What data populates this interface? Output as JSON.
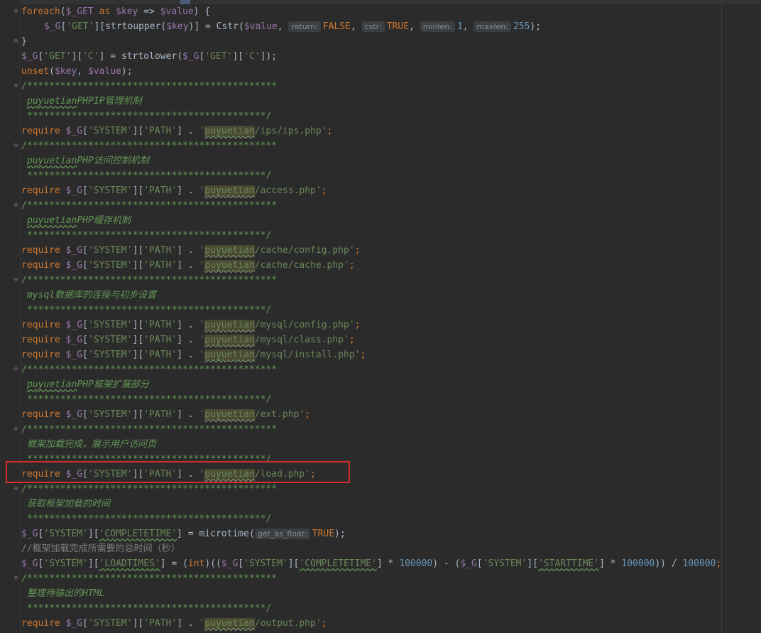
{
  "editor": {
    "accent_highlight": "#d32c2c",
    "lines": [
      {
        "fold": true,
        "segments": [
          [
            "kw",
            "foreach"
          ],
          [
            "",
            "("
          ],
          [
            "var",
            "$_GET"
          ],
          [
            "kw",
            " as "
          ],
          [
            "var",
            "$key"
          ],
          [
            "",
            " => "
          ],
          [
            "var",
            "$value"
          ],
          [
            "",
            ") {"
          ]
        ]
      },
      {
        "indent": true,
        "segments": [
          [
            "var",
            "$_G"
          ],
          [
            "",
            "["
          ],
          [
            "str",
            "'GET'"
          ],
          [
            "",
            "]["
          ],
          [
            "fn",
            "strtoupper"
          ],
          [
            "",
            "("
          ],
          [
            "var",
            "$key"
          ],
          [
            "",
            ")] = "
          ],
          [
            "fn",
            "Cstr"
          ],
          [
            "",
            "("
          ],
          [
            "var",
            "$value"
          ],
          [
            "",
            ", "
          ],
          [
            "hint",
            "return:"
          ],
          [
            "kw",
            "FALSE"
          ],
          [
            "",
            ", "
          ],
          [
            "hint",
            "cstr:"
          ],
          [
            "kw",
            "TRUE"
          ],
          [
            "",
            ", "
          ],
          [
            "hint",
            "minlen:"
          ],
          [
            "num",
            "1"
          ],
          [
            "",
            ", "
          ],
          [
            "hint",
            "maxlen:"
          ],
          [
            "num",
            "255"
          ],
          [
            "",
            ");"
          ]
        ]
      },
      {
        "fold": true,
        "segments": [
          [
            "",
            "}"
          ]
        ]
      },
      {
        "segments": [
          [
            "var",
            "$_G"
          ],
          [
            "",
            "["
          ],
          [
            "str",
            "'GET'"
          ],
          [
            "",
            "]["
          ],
          [
            "str",
            "'C'"
          ],
          [
            "",
            "] = "
          ],
          [
            "fn",
            "strtolower"
          ],
          [
            "",
            "("
          ],
          [
            "var",
            "$_G"
          ],
          [
            "",
            "["
          ],
          [
            "str",
            "'GET'"
          ],
          [
            "",
            "]["
          ],
          [
            "str",
            "'C'"
          ],
          [
            "",
            "]);"
          ]
        ]
      },
      {
        "segments": [
          [
            "kw",
            "unset"
          ],
          [
            "",
            "("
          ],
          [
            "var",
            "$key"
          ],
          [
            "",
            ", "
          ],
          [
            "var",
            "$value"
          ],
          [
            "",
            ");"
          ]
        ]
      },
      {
        "fold": true,
        "segments": [
          [
            "cmt",
            "/*********************************************"
          ]
        ]
      },
      {
        "comment": true,
        "segments": [
          [
            "cmti typo",
            "puyuetian"
          ],
          [
            "cmti",
            "PHPIP管理机制"
          ]
        ]
      },
      {
        "comment": true,
        "segments": [
          [
            "cmt",
            "*******************************************/"
          ]
        ]
      },
      {
        "segments": [
          [
            "kw",
            "require "
          ],
          [
            "var",
            "$_G"
          ],
          [
            "",
            "["
          ],
          [
            "str",
            "'SYSTEM'"
          ],
          [
            "",
            "]["
          ],
          [
            "str",
            "'PATH'"
          ],
          [
            "",
            "] . "
          ],
          [
            "str",
            "'"
          ],
          [
            "str hl",
            "puyuetian"
          ],
          [
            "str",
            "/ips/ips.php'"
          ],
          [
            "kw",
            ";"
          ]
        ]
      },
      {
        "fold": true,
        "segments": [
          [
            "cmt",
            "/*********************************************"
          ]
        ]
      },
      {
        "comment": true,
        "segments": [
          [
            "cmti typo",
            "puyuetian"
          ],
          [
            "cmti",
            "PHP访问控制机制"
          ]
        ]
      },
      {
        "comment": true,
        "segments": [
          [
            "cmt",
            "*******************************************/"
          ]
        ]
      },
      {
        "segments": [
          [
            "kw",
            "require "
          ],
          [
            "var",
            "$_G"
          ],
          [
            "",
            "["
          ],
          [
            "str",
            "'SYSTEM'"
          ],
          [
            "",
            "]["
          ],
          [
            "str",
            "'PATH'"
          ],
          [
            "",
            "] . "
          ],
          [
            "str",
            "'"
          ],
          [
            "str hl",
            "puyuetian"
          ],
          [
            "str",
            "/access.php'"
          ],
          [
            "kw",
            ";"
          ]
        ]
      },
      {
        "fold": true,
        "segments": [
          [
            "cmt",
            "/*********************************************"
          ]
        ]
      },
      {
        "comment": true,
        "segments": [
          [
            "cmti typo",
            "puyuetian"
          ],
          [
            "cmti",
            "PHP缓存机制"
          ]
        ]
      },
      {
        "comment": true,
        "segments": [
          [
            "cmt",
            "*******************************************/"
          ]
        ]
      },
      {
        "segments": [
          [
            "kw",
            "require "
          ],
          [
            "var",
            "$_G"
          ],
          [
            "",
            "["
          ],
          [
            "str",
            "'SYSTEM'"
          ],
          [
            "",
            "]["
          ],
          [
            "str",
            "'PATH'"
          ],
          [
            "",
            "] . "
          ],
          [
            "str",
            "'"
          ],
          [
            "str hl",
            "puyuetian"
          ],
          [
            "str",
            "/cache/config.php'"
          ],
          [
            "kw",
            ";"
          ]
        ]
      },
      {
        "segments": [
          [
            "kw",
            "require "
          ],
          [
            "var",
            "$_G"
          ],
          [
            "",
            "["
          ],
          [
            "str",
            "'SYSTEM'"
          ],
          [
            "",
            "]["
          ],
          [
            "str",
            "'PATH'"
          ],
          [
            "",
            "] . "
          ],
          [
            "str",
            "'"
          ],
          [
            "str hl",
            "puyuetian"
          ],
          [
            "str",
            "/cache/cache.php'"
          ],
          [
            "kw",
            ";"
          ]
        ]
      },
      {
        "fold": true,
        "segments": [
          [
            "cmt",
            "/*********************************************"
          ]
        ]
      },
      {
        "comment": true,
        "segments": [
          [
            "cmti",
            "mysql数据库的连接与初步设置"
          ]
        ]
      },
      {
        "comment": true,
        "segments": [
          [
            "cmt",
            "*******************************************/"
          ]
        ]
      },
      {
        "segments": [
          [
            "kw",
            "require "
          ],
          [
            "var",
            "$_G"
          ],
          [
            "",
            "["
          ],
          [
            "str",
            "'SYSTEM'"
          ],
          [
            "",
            "]["
          ],
          [
            "str",
            "'PATH'"
          ],
          [
            "",
            "] . "
          ],
          [
            "str",
            "'"
          ],
          [
            "str hl",
            "puyuetian"
          ],
          [
            "str",
            "/mysql/config.php'"
          ],
          [
            "kw",
            ";"
          ]
        ]
      },
      {
        "segments": [
          [
            "kw",
            "require "
          ],
          [
            "var",
            "$_G"
          ],
          [
            "",
            "["
          ],
          [
            "str",
            "'SYSTEM'"
          ],
          [
            "",
            "]["
          ],
          [
            "str",
            "'PATH'"
          ],
          [
            "",
            "] . "
          ],
          [
            "str",
            "'"
          ],
          [
            "str hl",
            "puyuetian"
          ],
          [
            "str",
            "/mysql/class.php'"
          ],
          [
            "kw",
            ";"
          ]
        ]
      },
      {
        "segments": [
          [
            "kw",
            "require "
          ],
          [
            "var",
            "$_G"
          ],
          [
            "",
            "["
          ],
          [
            "str",
            "'SYSTEM'"
          ],
          [
            "",
            "]["
          ],
          [
            "str",
            "'PATH'"
          ],
          [
            "",
            "] . "
          ],
          [
            "str",
            "'"
          ],
          [
            "str hl",
            "puyuetian"
          ],
          [
            "str",
            "/mysql/install.php'"
          ],
          [
            "kw",
            ";"
          ]
        ]
      },
      {
        "fold": true,
        "segments": [
          [
            "cmt",
            "/*********************************************"
          ]
        ]
      },
      {
        "comment": true,
        "segments": [
          [
            "cmti typo",
            "puyuetian"
          ],
          [
            "cmti",
            "PHP框架扩展部分"
          ]
        ]
      },
      {
        "comment": true,
        "segments": [
          [
            "cmt",
            "*******************************************/"
          ]
        ]
      },
      {
        "segments": [
          [
            "kw",
            "require "
          ],
          [
            "var",
            "$_G"
          ],
          [
            "",
            "["
          ],
          [
            "str",
            "'SYSTEM'"
          ],
          [
            "",
            "]["
          ],
          [
            "str",
            "'PATH'"
          ],
          [
            "",
            "] . "
          ],
          [
            "str",
            "'"
          ],
          [
            "str hl",
            "puyuetian"
          ],
          [
            "str",
            "/ext.php'"
          ],
          [
            "kw",
            ";"
          ]
        ]
      },
      {
        "fold": true,
        "segments": [
          [
            "cmt",
            "/*********************************************"
          ]
        ]
      },
      {
        "comment": true,
        "segments": [
          [
            "cmti",
            "框架加载完成，展示用户访问页"
          ]
        ]
      },
      {
        "comment": true,
        "segments": [
          [
            "cmt",
            "*******************************************/"
          ]
        ]
      },
      {
        "boxed": true,
        "segments": [
          [
            "kw",
            "require "
          ],
          [
            "var",
            "$_G"
          ],
          [
            "",
            "["
          ],
          [
            "str",
            "'SYSTEM'"
          ],
          [
            "",
            "]["
          ],
          [
            "str",
            "'PATH'"
          ],
          [
            "",
            "] . "
          ],
          [
            "str",
            "'"
          ],
          [
            "str hl",
            "puyuetian"
          ],
          [
            "str",
            "/load.php'"
          ],
          [
            "kw",
            ";"
          ]
        ]
      },
      {
        "fold": true,
        "segments": [
          [
            "cmt",
            "/*********************************************"
          ]
        ]
      },
      {
        "comment": true,
        "segments": [
          [
            "cmti",
            "获取框架加载的时间"
          ]
        ]
      },
      {
        "comment": true,
        "segments": [
          [
            "cmt",
            "*******************************************/"
          ]
        ]
      },
      {
        "segments": [
          [
            "var",
            "$_G"
          ],
          [
            "",
            "["
          ],
          [
            "str",
            "'SYSTEM'"
          ],
          [
            "",
            "]["
          ],
          [
            "str typo",
            "'COMPLETETIME'"
          ],
          [
            "",
            "] = "
          ],
          [
            "fn",
            "microtime"
          ],
          [
            "",
            "("
          ],
          [
            "hint",
            "get_as_float:"
          ],
          [
            "kw",
            "TRUE"
          ],
          [
            "",
            ");"
          ]
        ]
      },
      {
        "segments": [
          [
            "cmtg",
            "//框架加载完成所需要的总时间（秒）"
          ]
        ]
      },
      {
        "segments": [
          [
            "var",
            "$_G"
          ],
          [
            "",
            "["
          ],
          [
            "str",
            "'SYSTEM'"
          ],
          [
            "",
            "]["
          ],
          [
            "str typo",
            "'LOADTIMES'"
          ],
          [
            "",
            "] = ("
          ],
          [
            "kw",
            "int"
          ],
          [
            "",
            ")(("
          ],
          [
            "var",
            "$_G"
          ],
          [
            "",
            "["
          ],
          [
            "str",
            "'SYSTEM'"
          ],
          [
            "",
            "]["
          ],
          [
            "str typo",
            "'COMPLETETIME'"
          ],
          [
            "",
            "] * "
          ],
          [
            "num",
            "100000"
          ],
          [
            "",
            ") - ("
          ],
          [
            "var",
            "$_G"
          ],
          [
            "",
            "["
          ],
          [
            "str",
            "'SYSTEM'"
          ],
          [
            "",
            "]["
          ],
          [
            "str typo",
            "'STARTTIME'"
          ],
          [
            "",
            "] * "
          ],
          [
            "num",
            "100000"
          ],
          [
            "",
            ")) / "
          ],
          [
            "num",
            "100000"
          ],
          [
            "kw",
            ";"
          ]
        ]
      },
      {
        "fold": true,
        "segments": [
          [
            "cmt",
            "/*********************************************"
          ]
        ]
      },
      {
        "comment": true,
        "segments": [
          [
            "cmti",
            "整理待输出的HTML"
          ]
        ]
      },
      {
        "comment": true,
        "segments": [
          [
            "cmt",
            "*******************************************/"
          ]
        ]
      },
      {
        "segments": [
          [
            "kw",
            "require "
          ],
          [
            "var",
            "$_G"
          ],
          [
            "",
            "["
          ],
          [
            "str",
            "'SYSTEM'"
          ],
          [
            "",
            "]["
          ],
          [
            "str",
            "'PATH'"
          ],
          [
            "",
            "] . "
          ],
          [
            "str",
            "'"
          ],
          [
            "str hl",
            "puyuetian"
          ],
          [
            "str",
            "/output.php'"
          ],
          [
            "kw",
            ";"
          ]
        ]
      }
    ]
  }
}
